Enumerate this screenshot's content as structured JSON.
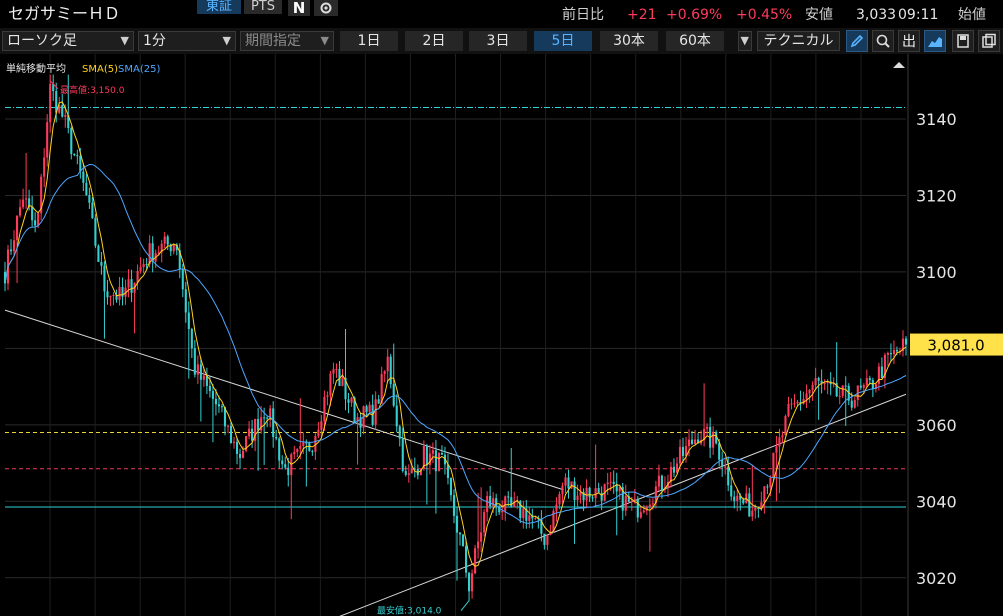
{
  "header": {
    "stock_name": "セガサミーＨＤ",
    "exchange_label": "東証",
    "pts_label": "PTS",
    "news_badge": "N",
    "prev_day_label": "前日比",
    "change_value": "+21",
    "change_percent": "+0.69%",
    "change_percent2": "+0.45%",
    "low_label": "安値",
    "low_value": "3,033",
    "time": "09:11",
    "open_label": "始値"
  },
  "toolbar": {
    "chart_type": "ローソク足",
    "interval": "1分",
    "period_select_placeholder": "期間指定",
    "periods": [
      "1日",
      "2日",
      "3日",
      "5日",
      "30本",
      "60本"
    ],
    "active_period": "5日",
    "technical_button": "テクニカル",
    "out_label": "出",
    "colors": {
      "accent": "#58b4ff",
      "up": "#ff3b5c",
      "down": "#36d0d0"
    },
    "icons": [
      "pencil-icon",
      "zoom-icon",
      "area-chart-icon",
      "save-icon",
      "copy-icon"
    ]
  },
  "chart_data": {
    "type": "candlestick",
    "indicator_title": "単純移動平均",
    "series": [
      {
        "name": "SMA(5)",
        "color": "#ffd21f"
      },
      {
        "name": "SMA(25)",
        "color": "#4ea6ff"
      }
    ],
    "high_annotation": "最高値:3,150.0",
    "low_annotation": "最安値:3,014.0",
    "high": 3150.0,
    "low": 3014.0,
    "current_price": 3081.0,
    "current_price_label": "3,081.0",
    "ylim": [
      3010,
      3157
    ],
    "yticks": [
      3020,
      3040,
      3060,
      3080,
      3100,
      3120,
      3140
    ],
    "ytick_labels": [
      "3020",
      "3040",
      "3060",
      "",
      "3100",
      "3120",
      "3140"
    ],
    "horizontal_lines": [
      {
        "value": 3143,
        "color": "#2fd3d3",
        "style": "dashdot"
      },
      {
        "value": 3058,
        "color": "#e8d23a",
        "style": "dashed"
      },
      {
        "value": 3048.5,
        "color": "#e83a5a",
        "style": "dashed"
      },
      {
        "value": 3038.5,
        "color": "#2fd3d3",
        "style": "solid"
      }
    ],
    "trend_lines": [
      {
        "t0": 0,
        "p0": 3090,
        "t1": 0.62,
        "p1": 3043
      },
      {
        "t0": 0.34,
        "p0": 3007,
        "t1": 1.0,
        "p1": 3068
      }
    ],
    "path_anchors": [
      [
        0.0,
        3100
      ],
      [
        0.02,
        3120
      ],
      [
        0.035,
        3110
      ],
      [
        0.05,
        3148
      ],
      [
        0.065,
        3140
      ],
      [
        0.09,
        3120
      ],
      [
        0.11,
        3096
      ],
      [
        0.13,
        3093
      ],
      [
        0.16,
        3105
      ],
      [
        0.19,
        3108
      ],
      [
        0.21,
        3075
      ],
      [
        0.235,
        3065
      ],
      [
        0.26,
        3052
      ],
      [
        0.29,
        3065
      ],
      [
        0.31,
        3048
      ],
      [
        0.34,
        3055
      ],
      [
        0.365,
        3075
      ],
      [
        0.39,
        3062
      ],
      [
        0.41,
        3063
      ],
      [
        0.425,
        3077
      ],
      [
        0.445,
        3045
      ],
      [
        0.465,
        3052
      ],
      [
        0.485,
        3050
      ],
      [
        0.505,
        3030
      ],
      [
        0.515,
        3018
      ],
      [
        0.535,
        3040
      ],
      [
        0.56,
        3038
      ],
      [
        0.58,
        3037
      ],
      [
        0.6,
        3030
      ],
      [
        0.62,
        3045
      ],
      [
        0.64,
        3042
      ],
      [
        0.67,
        3043
      ],
      [
        0.7,
        3038
      ],
      [
        0.73,
        3045
      ],
      [
        0.77,
        3058
      ],
      [
        0.79,
        3055
      ],
      [
        0.81,
        3041
      ],
      [
        0.83,
        3038
      ],
      [
        0.85,
        3048
      ],
      [
        0.87,
        3063
      ],
      [
        0.9,
        3071
      ],
      [
        0.92,
        3068
      ],
      [
        0.94,
        3067
      ],
      [
        0.96,
        3070
      ],
      [
        0.98,
        3077
      ],
      [
        1.0,
        3081
      ]
    ]
  }
}
